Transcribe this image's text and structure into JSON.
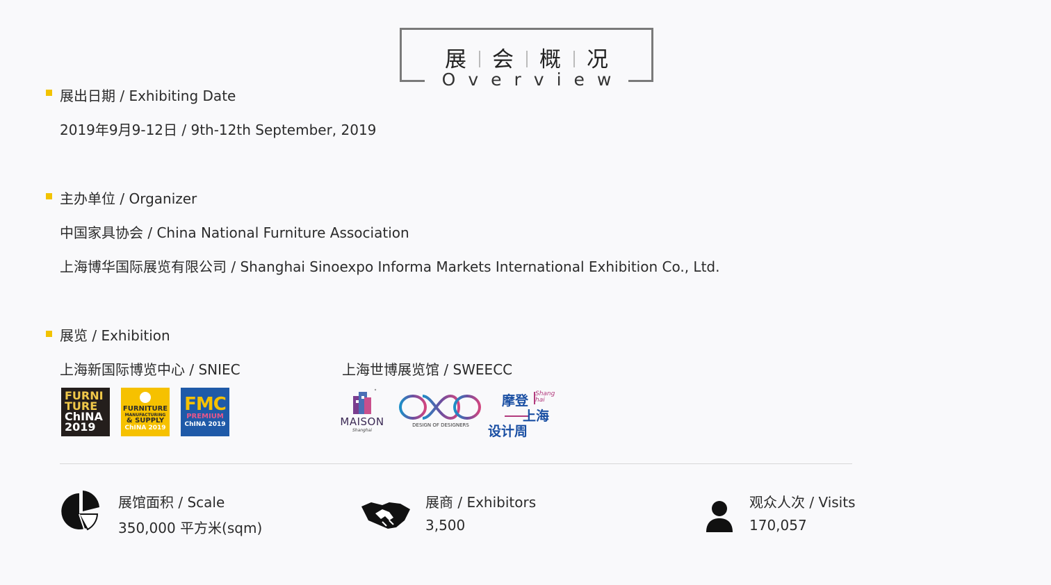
{
  "title": {
    "cn_chars": [
      "展",
      "会",
      "概",
      "况"
    ],
    "en": "Overview"
  },
  "sections": {
    "date": {
      "heading": "展出日期 / Exhibiting Date",
      "value": "2019年9月9-12日 / 9th-12th September, 2019"
    },
    "organizer": {
      "heading": "主办单位 / Organizer",
      "lines": [
        "中国家具协会 / China National Furniture Association",
        "上海博华国际展览有限公司 / Shanghai Sinoexpo Informa Markets International Exhibition Co., Ltd."
      ]
    },
    "exhibition": {
      "heading": "展览 / Exhibition",
      "venues": [
        {
          "name": "上海新国际博览中心 / SNIEC"
        },
        {
          "name": "上海世博展览馆 / SWEECC"
        }
      ],
      "logos_sniec": {
        "furniture_china": {
          "l1": "FURNI",
          "l2": "TURE",
          "l3": "ChINA",
          "l4": "2019"
        },
        "fmc": {
          "top": "FURNITURE",
          "mid": "MANUFACTURING",
          "sub": "& SUPPLY",
          "bottom": "ChINA 2019"
        },
        "fmc_premium": {
          "big": "FMC",
          "pr": "PREMIUM",
          "cn": "ChINA 2019"
        }
      },
      "logos_sweecc": {
        "maison": {
          "name": "MAISON",
          "sub": "Shanghai"
        },
        "dod": {
          "caption": "DESIGN OF DESIGNERS"
        },
        "modern_shanghai": {
          "l1": "摩登",
          "l2": "上海",
          "l3": "设计周",
          "shang": "Shang",
          "hai": "hai"
        }
      }
    }
  },
  "stats": [
    {
      "icon": "pie-chart-icon",
      "label": "展馆面积 / Scale",
      "value": "350,000 平方米(sqm)"
    },
    {
      "icon": "handshake-icon",
      "label": "展商 / Exhibitors",
      "value": "3,500"
    },
    {
      "icon": "person-icon",
      "label": "观众人次 / Visits",
      "value": "170,057"
    }
  ],
  "colors": {
    "bullet": "#f2c300",
    "text": "#2b2b2b",
    "frame": "#7a7a7a",
    "background": "#f9f9fb"
  }
}
